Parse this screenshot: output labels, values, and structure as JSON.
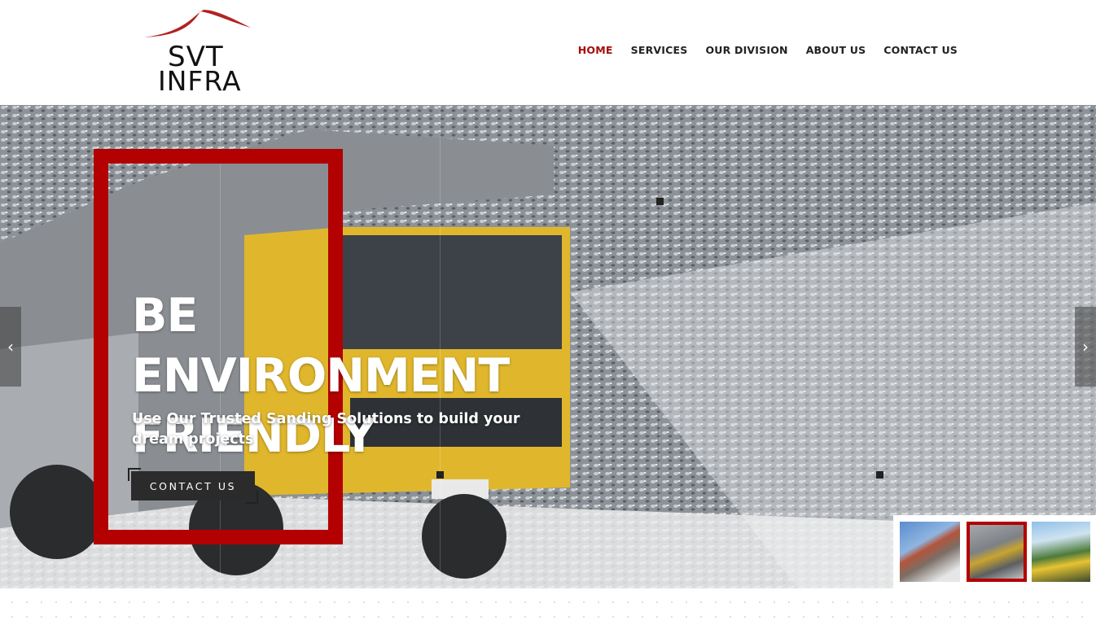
{
  "brand": {
    "line1": "SVT",
    "line2": "INFRA",
    "accent": "#b22222"
  },
  "nav": [
    {
      "label": "HOME",
      "active": true
    },
    {
      "label": "SERVICES",
      "active": false
    },
    {
      "label": "OUR DIVISION",
      "active": false
    },
    {
      "label": "ABOUT US",
      "active": false
    },
    {
      "label": "CONTACT US",
      "active": false
    }
  ],
  "hero": {
    "title_line1": "BE ENVIRONMENT",
    "title_line2": "FRIENDLY",
    "subtitle": "Use Our Trusted Sanding Solutions to build your dream projects",
    "cta_label": "CONTACT US",
    "prev_icon": "chevron-left-icon",
    "next_icon": "chevron-right-icon",
    "prev_glyph": "‹",
    "next_glyph": "›",
    "frame_color": "#b30000"
  },
  "thumbnails": [
    {
      "name": "thumb-conveyor",
      "active": false
    },
    {
      "name": "thumb-dump-truck",
      "active": true
    },
    {
      "name": "thumb-yellow-truck",
      "active": false
    }
  ]
}
